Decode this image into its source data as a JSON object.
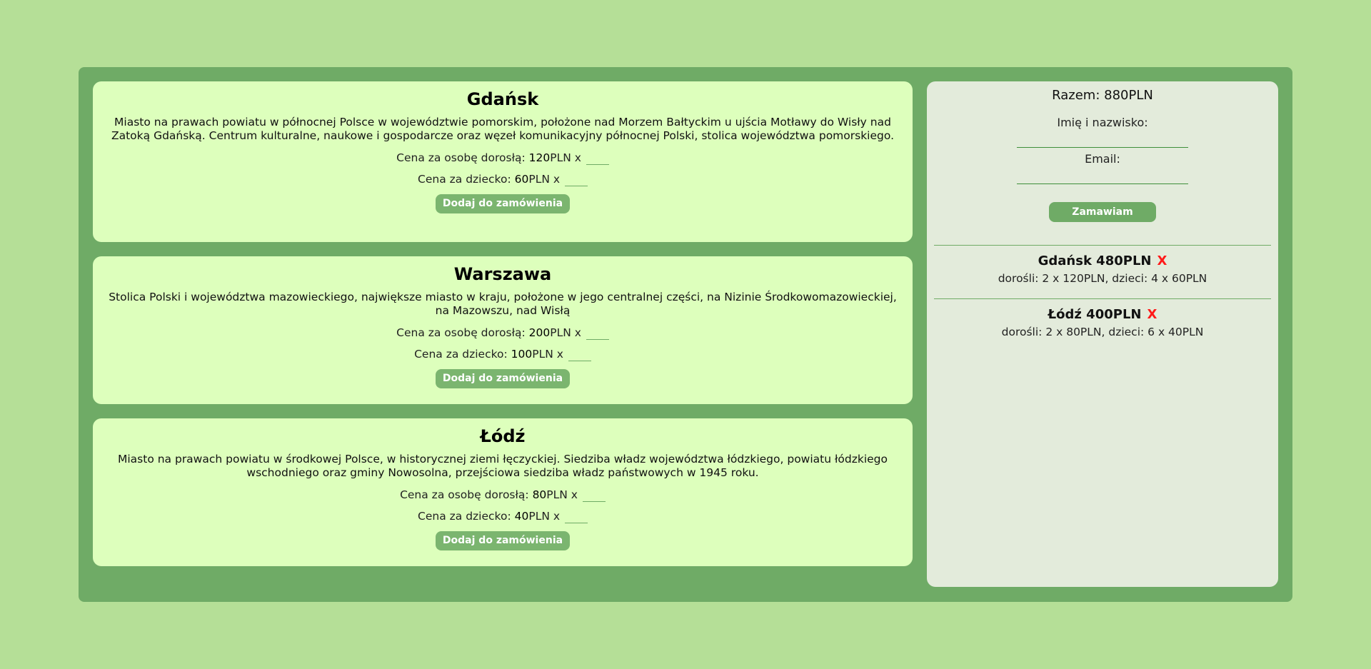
{
  "offers": [
    {
      "city": "Gdańsk",
      "description": "Miasto na prawach powiatu w północnej Polsce w województwie pomorskim, położone nad Morzem Bałtyckim u ujścia Motławy do Wisły nad Zatoką Gdańską. Centrum kulturalne, naukowe i gospodarcze oraz węzeł komunikacyjny północnej Polski, stolica województwa pomorskiego.",
      "adult_label": "Cena za osobę dorosłą: ",
      "adult_price": "120",
      "child_label": "Cena za dziecko: ",
      "child_price": "60",
      "currency_x": "PLN x",
      "button_label": "Dodaj do zamówienia"
    },
    {
      "city": "Warszawa",
      "description": "Stolica Polski i województwa mazowieckiego, największe miasto w kraju, położone w jego centralnej części, na Nizinie Środkowomazowieckiej, na Mazowszu, nad Wisłą",
      "adult_label": "Cena za osobę dorosłą: ",
      "adult_price": "200",
      "child_label": "Cena za dziecko: ",
      "child_price": "100",
      "currency_x": "PLN x",
      "button_label": "Dodaj do zamówienia"
    },
    {
      "city": "Łódź",
      "description": "Miasto na prawach powiatu w środkowej Polsce, w historycznej ziemi łęczyckiej. Siedziba władz województwa łódzkiego, powiatu łódzkiego wschodniego oraz gminy Nowosolna, przejściowa siedziba władz państwowych w 1945 roku.",
      "adult_label": "Cena za osobę dorosłą: ",
      "adult_price": "80",
      "child_label": "Cena za dziecko: ",
      "child_price": "40",
      "currency_x": "PLN x",
      "button_label": "Dodaj do zamówienia"
    }
  ],
  "cart": {
    "total": "Razem: 880PLN",
    "name_label": "Imię i nazwisko:",
    "email_label": "Email:",
    "name_value": "",
    "email_value": "",
    "order_button": "Zamawiam",
    "remove_symbol": "X",
    "items": [
      {
        "title": "Gdańsk 480PLN",
        "detail": "dorośli: 2 x 120PLN, dzieci: 4 x 60PLN"
      },
      {
        "title": "Łódź 400PLN",
        "detail": "dorośli: 2 x 80PLN, dzieci: 6 x 40PLN"
      }
    ]
  },
  "colors": {
    "page_bg": "#b5df97",
    "frame_bg": "#6fab66",
    "card_bg": "#ddffbc",
    "cart_bg": "#e3ebdb",
    "button_bg": "#7bb56f",
    "remove_x": "#ff1a1a"
  }
}
